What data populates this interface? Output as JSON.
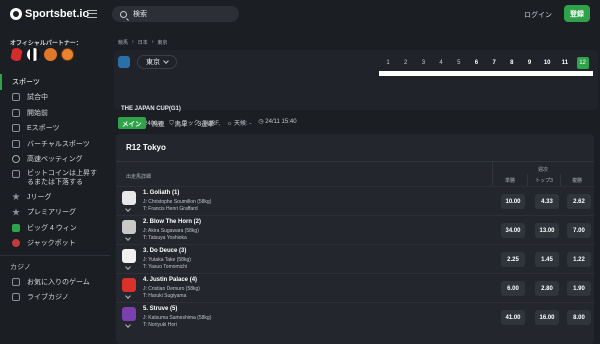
{
  "header": {
    "brand": "Sportsbet.io",
    "search_placeholder": "検索",
    "login_label": "ログイン",
    "signup_label": "登録"
  },
  "sidebar": {
    "partner_title": "オフィシャルパートナー：",
    "partner_logos": [
      "partner-logo-red",
      "partner-logo-newcastle",
      "partner-logo-orange-crest",
      "partner-logo-basketball"
    ],
    "sports_label": "スポーツ",
    "items": [
      {
        "label": "試合中",
        "icon": "tv-icon"
      },
      {
        "label": "開始前",
        "icon": "calendar-icon"
      },
      {
        "label": "Eスポーツ",
        "icon": "gamepad-icon"
      },
      {
        "label": "バーチャルスポーツ",
        "icon": "monitor-icon"
      },
      {
        "label": "高速ベッティング",
        "icon": "lightning-icon"
      },
      {
        "label": "ビットコインは上昇するまたは下落する",
        "icon": "bitcoin-icon"
      },
      {
        "label": "Jリーグ",
        "icon": "star-icon"
      },
      {
        "label": "プレミアリーグ",
        "icon": "star-icon"
      },
      {
        "label": "ビッグ 4 ウィン",
        "icon": "number-4-icon"
      },
      {
        "label": "ジャックポット",
        "icon": "target-icon"
      }
    ],
    "casino_label": "カジノ",
    "casino_items": [
      {
        "label": "お気に入りのゲーム",
        "icon": "heart-icon"
      },
      {
        "label": "ライブカジノ",
        "icon": "cards-icon"
      }
    ]
  },
  "breadcrumb": [
    "競馬",
    "日本",
    "東京"
  ],
  "venue": {
    "name": "東京"
  },
  "race_tabs": [
    "1",
    "2",
    "3",
    "4",
    "5",
    "6",
    "7",
    "8",
    "9",
    "10",
    "11",
    "12"
  ],
  "race_tabs_bold": [
    "6",
    "7",
    "8",
    "9",
    "10",
    "11"
  ],
  "selected_race": "12",
  "race": {
    "title": "THE JAPAN CUP(G1)",
    "distance": "距離: 2400m",
    "track": "トラック: TURF,",
    "weather": "天候: -",
    "datetime": "24/11 15:40"
  },
  "market_tabs": [
    "メイン",
    "馬連",
    "馬単",
    "3連単"
  ],
  "active_market_tab": "メイン",
  "card": {
    "title": "R12 Tokyo",
    "col_runner": "出走馬詳細",
    "col_group": "週次",
    "col_win": "単勝",
    "col_top3": "トップ3",
    "col_fixed": "複勝"
  },
  "runners": [
    {
      "name": "1. Goliath (1)",
      "jockey": "J: Christophe Soumillon (58kg)",
      "trainer": "T: Francis Henri Graffard",
      "win": "10.00",
      "top3": "4.33",
      "place": "2.62",
      "silk_color": "#e8e8e8"
    },
    {
      "name": "2. Blow The Horn (2)",
      "jockey": "J: Akira Sugawara (58kg)",
      "trainer": "T: Tatsuya Yoshioka",
      "win": "34.00",
      "top3": "13.00",
      "place": "7.00",
      "silk_color": "#c8c8c8"
    },
    {
      "name": "3. Do Deuce (3)",
      "jockey": "J: Yutaka Take (58kg)",
      "trainer": "T: Yasuo Tomomichi",
      "win": "2.25",
      "top3": "1.45",
      "place": "1.22",
      "silk_color": "#f0f0f0"
    },
    {
      "name": "4. Justin Palace (4)",
      "jockey": "J: Cristian Demuro (58kg)",
      "trainer": "T: Haruki Sugiyama",
      "win": "6.00",
      "top3": "2.80",
      "place": "1.90",
      "silk_color": "#d9322a"
    },
    {
      "name": "5. Struve (5)",
      "jockey": "J: Katsuma Sameshima (58kg)",
      "trainer": "T: Noriyuki Hori",
      "win": "41.00",
      "top3": "16.00",
      "place": "8.00",
      "silk_color": "#7b3fb0"
    }
  ]
}
